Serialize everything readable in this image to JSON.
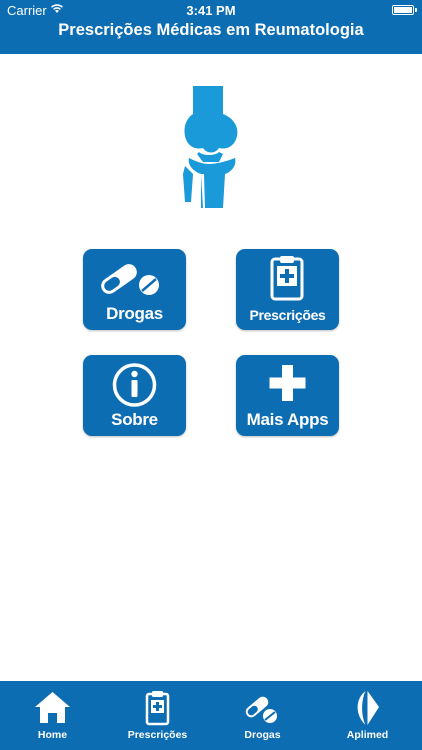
{
  "status_bar": {
    "carrier": "Carrier",
    "time": "3:41 PM"
  },
  "header": {
    "title": "Prescrições Médicas em Reumatologia"
  },
  "menu": {
    "drogas": "Drogas",
    "prescricoes": "Prescrições",
    "sobre": "Sobre",
    "mais_apps": "Mais Apps"
  },
  "tabs": {
    "home": "Home",
    "prescricoes": "Prescrições",
    "drogas": "Drogas",
    "aplimed": "Aplimed"
  },
  "colors": {
    "brand": "#0d6db3",
    "logo": "#1a9ad9",
    "background": "#ffffff"
  }
}
